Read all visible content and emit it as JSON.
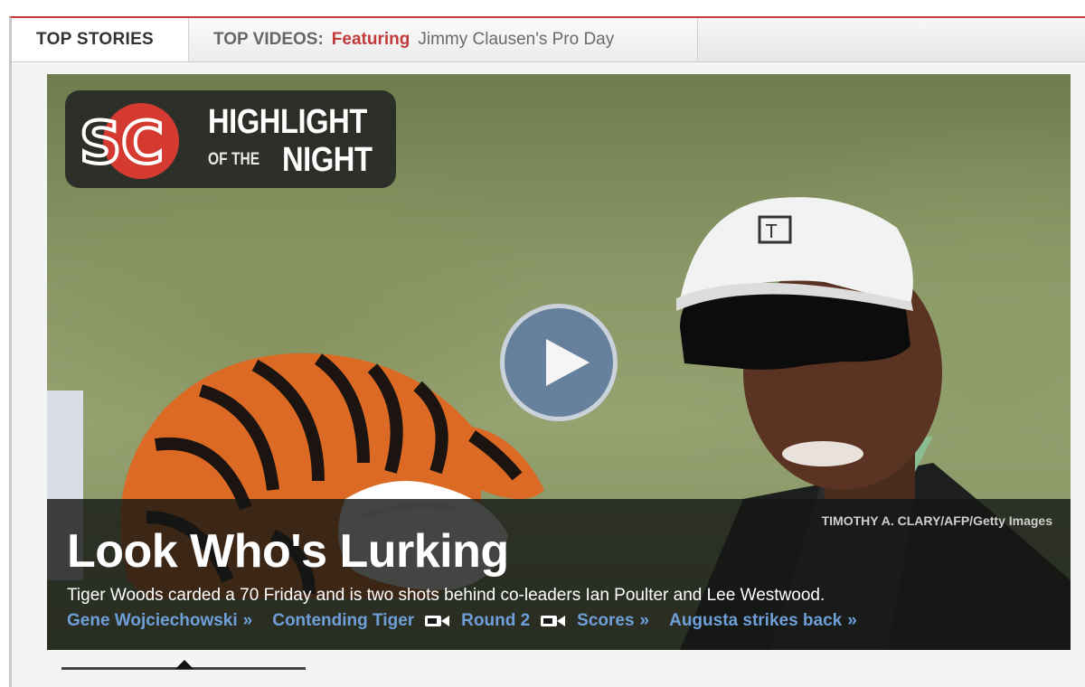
{
  "tabs": {
    "top_stories": "TOP STORIES",
    "top_videos": "TOP VIDEOS:",
    "featuring": "Featuring",
    "featured_video": "Jimmy Clausen's Pro Day"
  },
  "badge": {
    "logo_text": "SC",
    "line1": "HIGHLIGHT",
    "line2_small": "OF THE",
    "line2_big": "NIGHT"
  },
  "photo_credit": "TIMOTHY A. CLARY/AFP/Getty Images",
  "story": {
    "title": "Look Who's Lurking",
    "dek": "Tiger Woods carded a 70 Friday and is two shots behind co-leaders Ian Poulter and Lee Westwood."
  },
  "links": [
    {
      "label": "Gene Wojciechowski",
      "suffix": "»"
    },
    {
      "label": "Contending Tiger",
      "icon": "video-icon"
    },
    {
      "label": "Round 2",
      "icon": "video-icon"
    },
    {
      "label": "Scores",
      "suffix": "»"
    },
    {
      "label": "Augusta strikes back",
      "suffix": "»"
    }
  ],
  "colors": {
    "accent_red": "#c23a3a",
    "link_blue": "#6f9fd8",
    "caption_bg": "#141614"
  }
}
